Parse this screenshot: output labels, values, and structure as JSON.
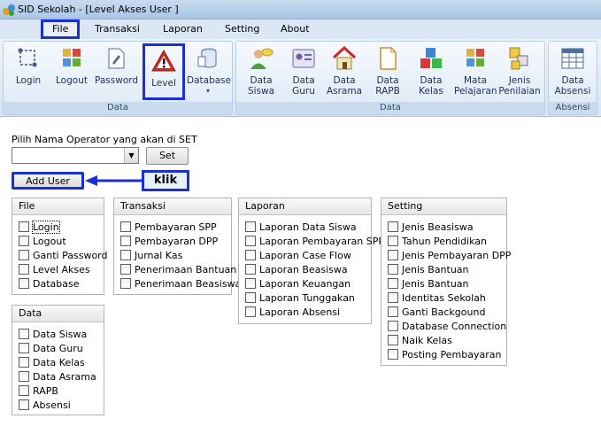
{
  "window": {
    "title": "SID Sekolah - [Level Akses User ]"
  },
  "menu": [
    "File",
    "Transaksi",
    "Laporan",
    "Setting",
    "About"
  ],
  "ribbon": {
    "group_data_left": {
      "label": "Data",
      "buttons": [
        "Login",
        "Logout",
        "Password",
        "Level",
        "Database"
      ]
    },
    "group_data_right": {
      "label": "Data",
      "buttons": [
        [
          "Data",
          "Siswa"
        ],
        [
          "Data",
          "Guru"
        ],
        [
          "Data",
          "Asrama"
        ],
        [
          "Data",
          "RAPB"
        ],
        [
          "Data",
          "Kelas"
        ],
        [
          "Mata",
          "Pelajaran"
        ],
        [
          "Jenis",
          "Penilaian"
        ]
      ]
    },
    "group_absensi": {
      "label": "Absensi",
      "button": [
        "Data",
        "Absensi"
      ]
    }
  },
  "form": {
    "operator_label": "Pilih Nama Operator yang akan di SET",
    "operator_value": "",
    "set_label": "Set",
    "add_user_label": "Add User",
    "callout": "klik"
  },
  "boxes": {
    "file": {
      "title": "File",
      "items": [
        "Login",
        "Logout",
        "Ganti Password",
        "Level Akses",
        "Database"
      ]
    },
    "transaksi": {
      "title": "Transaksi",
      "items": [
        "Pembayaran SPP",
        "Pembayaran DPP",
        "Jurnal Kas",
        "Penerimaan Bantuan",
        "Penerimaan Beasiswa"
      ]
    },
    "laporan": {
      "title": "Laporan",
      "items": [
        "Laporan Data Siswa",
        "Laporan Pembayaran SPP",
        "Laporan Case Flow",
        "Laporan Beasiswa",
        "Laporan Keuangan",
        "Laporan Tunggakan",
        "Laporan Absensi"
      ]
    },
    "setting": {
      "title": "Setting",
      "items": [
        "Jenis Beasiswa",
        "Tahun Pendidikan",
        "Jenis Pembayaran DPP",
        "Jenis Bantuan",
        "Jenis Bantuan",
        "Identitas Sekolah",
        "Ganti Backgound",
        "Database Connection",
        "Naik Kelas",
        "Posting Pembayaran"
      ]
    },
    "data": {
      "title": "Data",
      "items": [
        "Data Siswa",
        "Data Guru",
        "Data Kelas",
        "Data Asrama",
        "RAPB",
        "Absensi"
      ]
    }
  }
}
